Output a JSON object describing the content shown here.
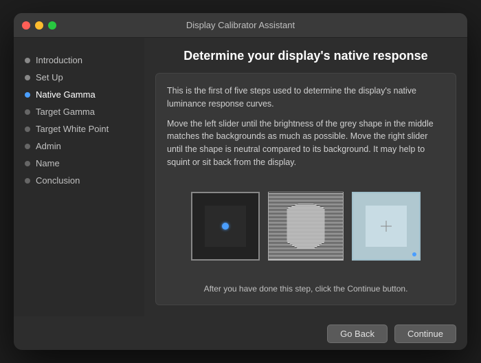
{
  "window": {
    "title": "Display Calibrator Assistant"
  },
  "sidebar": {
    "items": [
      {
        "id": "introduction",
        "label": "Introduction",
        "state": "completed"
      },
      {
        "id": "setup",
        "label": "Set Up",
        "state": "completed"
      },
      {
        "id": "native-gamma",
        "label": "Native Gamma",
        "state": "active"
      },
      {
        "id": "target-gamma",
        "label": "Target Gamma",
        "state": "inactive"
      },
      {
        "id": "target-white-point",
        "label": "Target White Point",
        "state": "inactive"
      },
      {
        "id": "admin",
        "label": "Admin",
        "state": "inactive"
      },
      {
        "id": "name",
        "label": "Name",
        "state": "inactive"
      },
      {
        "id": "conclusion",
        "label": "Conclusion",
        "state": "inactive"
      }
    ]
  },
  "main": {
    "title": "Determine your display's native response",
    "description1": "This is the first of five steps used to determine the display's native luminance response curves.",
    "description2": "Move the left slider until the brightness of the grey shape in the middle matches the backgrounds as much as possible. Move the right slider until the shape is neutral compared to its background. It may help to squint or sit back from the display.",
    "footer_text": "After you have done this step, click the Continue button."
  },
  "buttons": {
    "go_back": "Go Back",
    "continue": "Continue"
  }
}
